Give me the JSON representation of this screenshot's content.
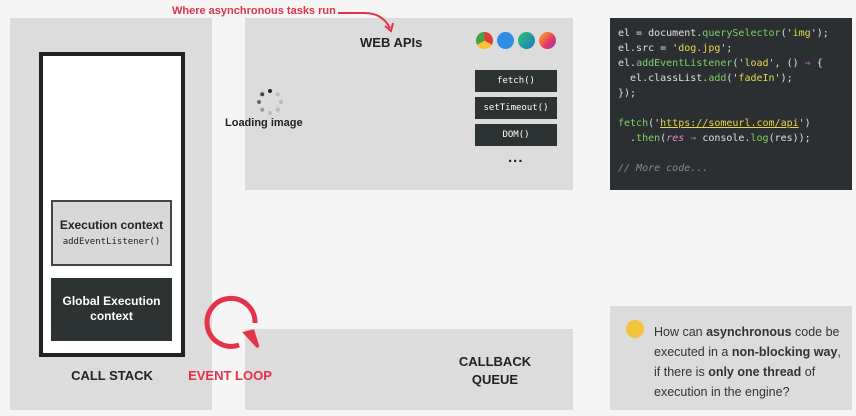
{
  "annotation": {
    "async_label": "Where asynchronous tasks run"
  },
  "call_stack": {
    "label": "CALL STACK",
    "execution_context": {
      "title": "Execution context",
      "fn": "addEventListener()"
    },
    "global_context": {
      "line1": "Global Execution",
      "line2": "context"
    }
  },
  "event_loop": {
    "label": "EVENT LOOP"
  },
  "web_apis": {
    "label": "WEB APIs",
    "loading_label": "Loading image",
    "browsers": [
      "chrome-icon",
      "safari-icon",
      "edge-icon",
      "firefox-icon"
    ],
    "apis": [
      "fetch()",
      "setTimeout()",
      "DOM()"
    ],
    "more": "..."
  },
  "callback_queue": {
    "line1": "CALLBACK",
    "line2": "QUEUE"
  },
  "code": {
    "l1a": "el = document.",
    "l1b": "querySelector",
    "l1c": "('",
    "l1d": "img",
    "l1e": "');",
    "l2a": "el.src = '",
    "l2b": "dog.jpg",
    "l2c": "';",
    "l3a": "el.",
    "l3b": "addEventListener",
    "l3c": "('",
    "l3d": "load",
    "l3e": "', () ",
    "l3f": "⇒",
    "l3g": " {",
    "l4a": "  el.classList.",
    "l4b": "add",
    "l4c": "('",
    "l4d": "fadeIn",
    "l4e": "');",
    "l5": "});",
    "l6a": "fetch",
    "l6b": "('",
    "l6c": "https://someurl.com/api",
    "l6d": "')",
    "l7a": "  .",
    "l7b": "then",
    "l7c": "(",
    "l7d": "res",
    "l7e": " ⇒ ",
    "l7f": "console",
    "l7g": ".",
    "l7h": "log",
    "l7i": "(res));",
    "l8": "// More code..."
  },
  "question": {
    "p1": "How can ",
    "b1": "asynchronous",
    "p2": " code be executed in a ",
    "b2": "non-blocking way",
    "p3": ", if there is ",
    "b3": "only one thread",
    "p4": " of execution in the engine?"
  },
  "colors": {
    "accent": "#e2334a",
    "panel": "#dcdcdc",
    "dark": "#2d3233"
  }
}
